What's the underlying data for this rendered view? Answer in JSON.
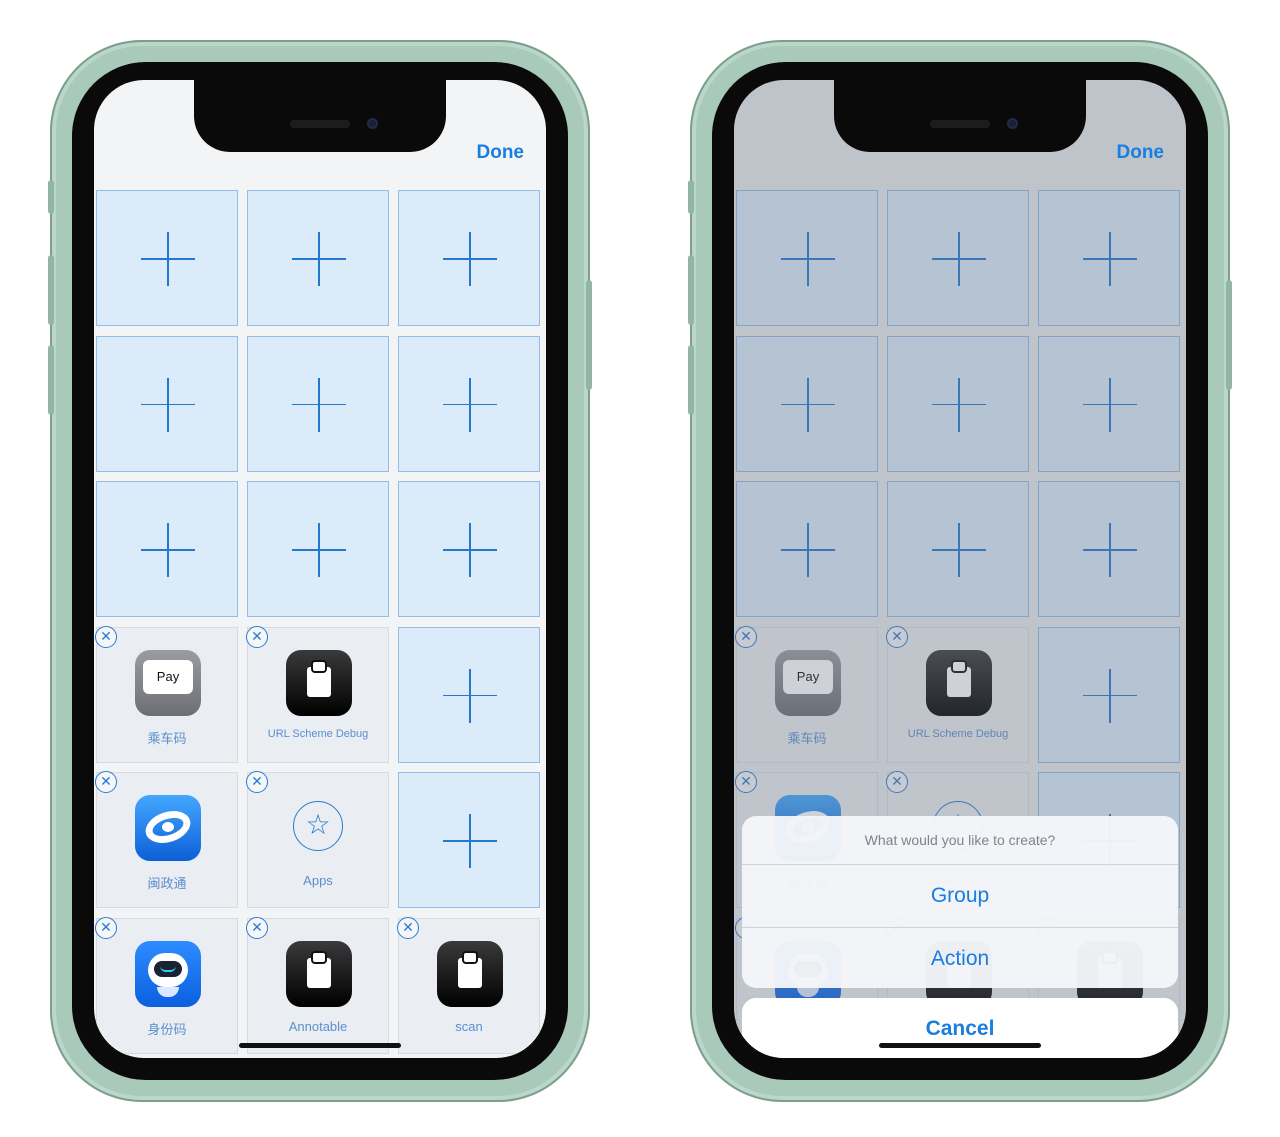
{
  "left_phone": {
    "done_label": "Done",
    "cells": [
      {
        "type": "add"
      },
      {
        "type": "add"
      },
      {
        "type": "add"
      },
      {
        "type": "add"
      },
      {
        "type": "add"
      },
      {
        "type": "add"
      },
      {
        "type": "add"
      },
      {
        "type": "add"
      },
      {
        "type": "add"
      },
      {
        "type": "app",
        "icon": "apple-pay-icon",
        "label": "乘车码"
      },
      {
        "type": "app",
        "icon": "clipboard-icon",
        "label": "URL Scheme Debug"
      },
      {
        "type": "add"
      },
      {
        "type": "app",
        "icon": "minzhengtong-icon",
        "label": "闽政通"
      },
      {
        "type": "app",
        "icon": "star-circle-icon",
        "label": "Apps"
      },
      {
        "type": "add"
      },
      {
        "type": "app",
        "icon": "robot-icon",
        "label": "身份码"
      },
      {
        "type": "app",
        "icon": "clipboard-icon",
        "label": "Annotable"
      },
      {
        "type": "app",
        "icon": "clipboard-icon",
        "label": "scan"
      }
    ]
  },
  "right_phone": {
    "done_label": "Done",
    "action_sheet": {
      "title": "What would you like to create?",
      "options": [
        "Group",
        "Action"
      ],
      "cancel_label": "Cancel"
    }
  },
  "icons": {
    "remove": "✕",
    "apple_pay_text": "Pay",
    "apple_glyph": "",
    "star": "☆"
  },
  "colors": {
    "accent": "#1a7de0",
    "phone_frame": "#a9c9ba",
    "add_cell_fill": "#dcebfa"
  }
}
